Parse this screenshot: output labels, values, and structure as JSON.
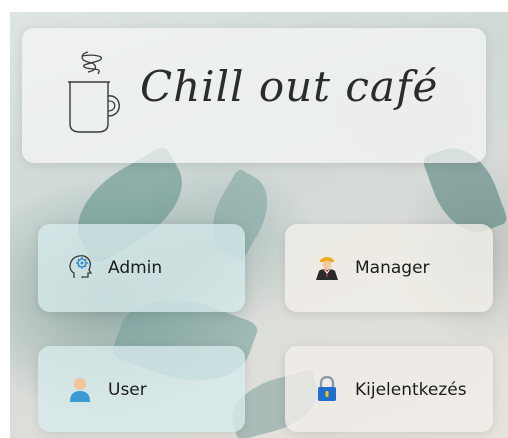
{
  "brand": {
    "name": "Chill out café",
    "icon": "coffee-mug-icon"
  },
  "menu": {
    "admin": {
      "label": "Admin",
      "icon": "head-gear-icon",
      "icon_color": "#3a8fd0"
    },
    "manager": {
      "label": "Manager",
      "icon": "manager-person-icon",
      "icon_color": "#2a2a2a"
    },
    "user": {
      "label": "User",
      "icon": "user-person-icon",
      "icon_color": "#3a9ad6"
    },
    "logout": {
      "label": "Kijelentkezés",
      "icon": "padlock-icon",
      "icon_color": "#1f6fd1"
    }
  }
}
